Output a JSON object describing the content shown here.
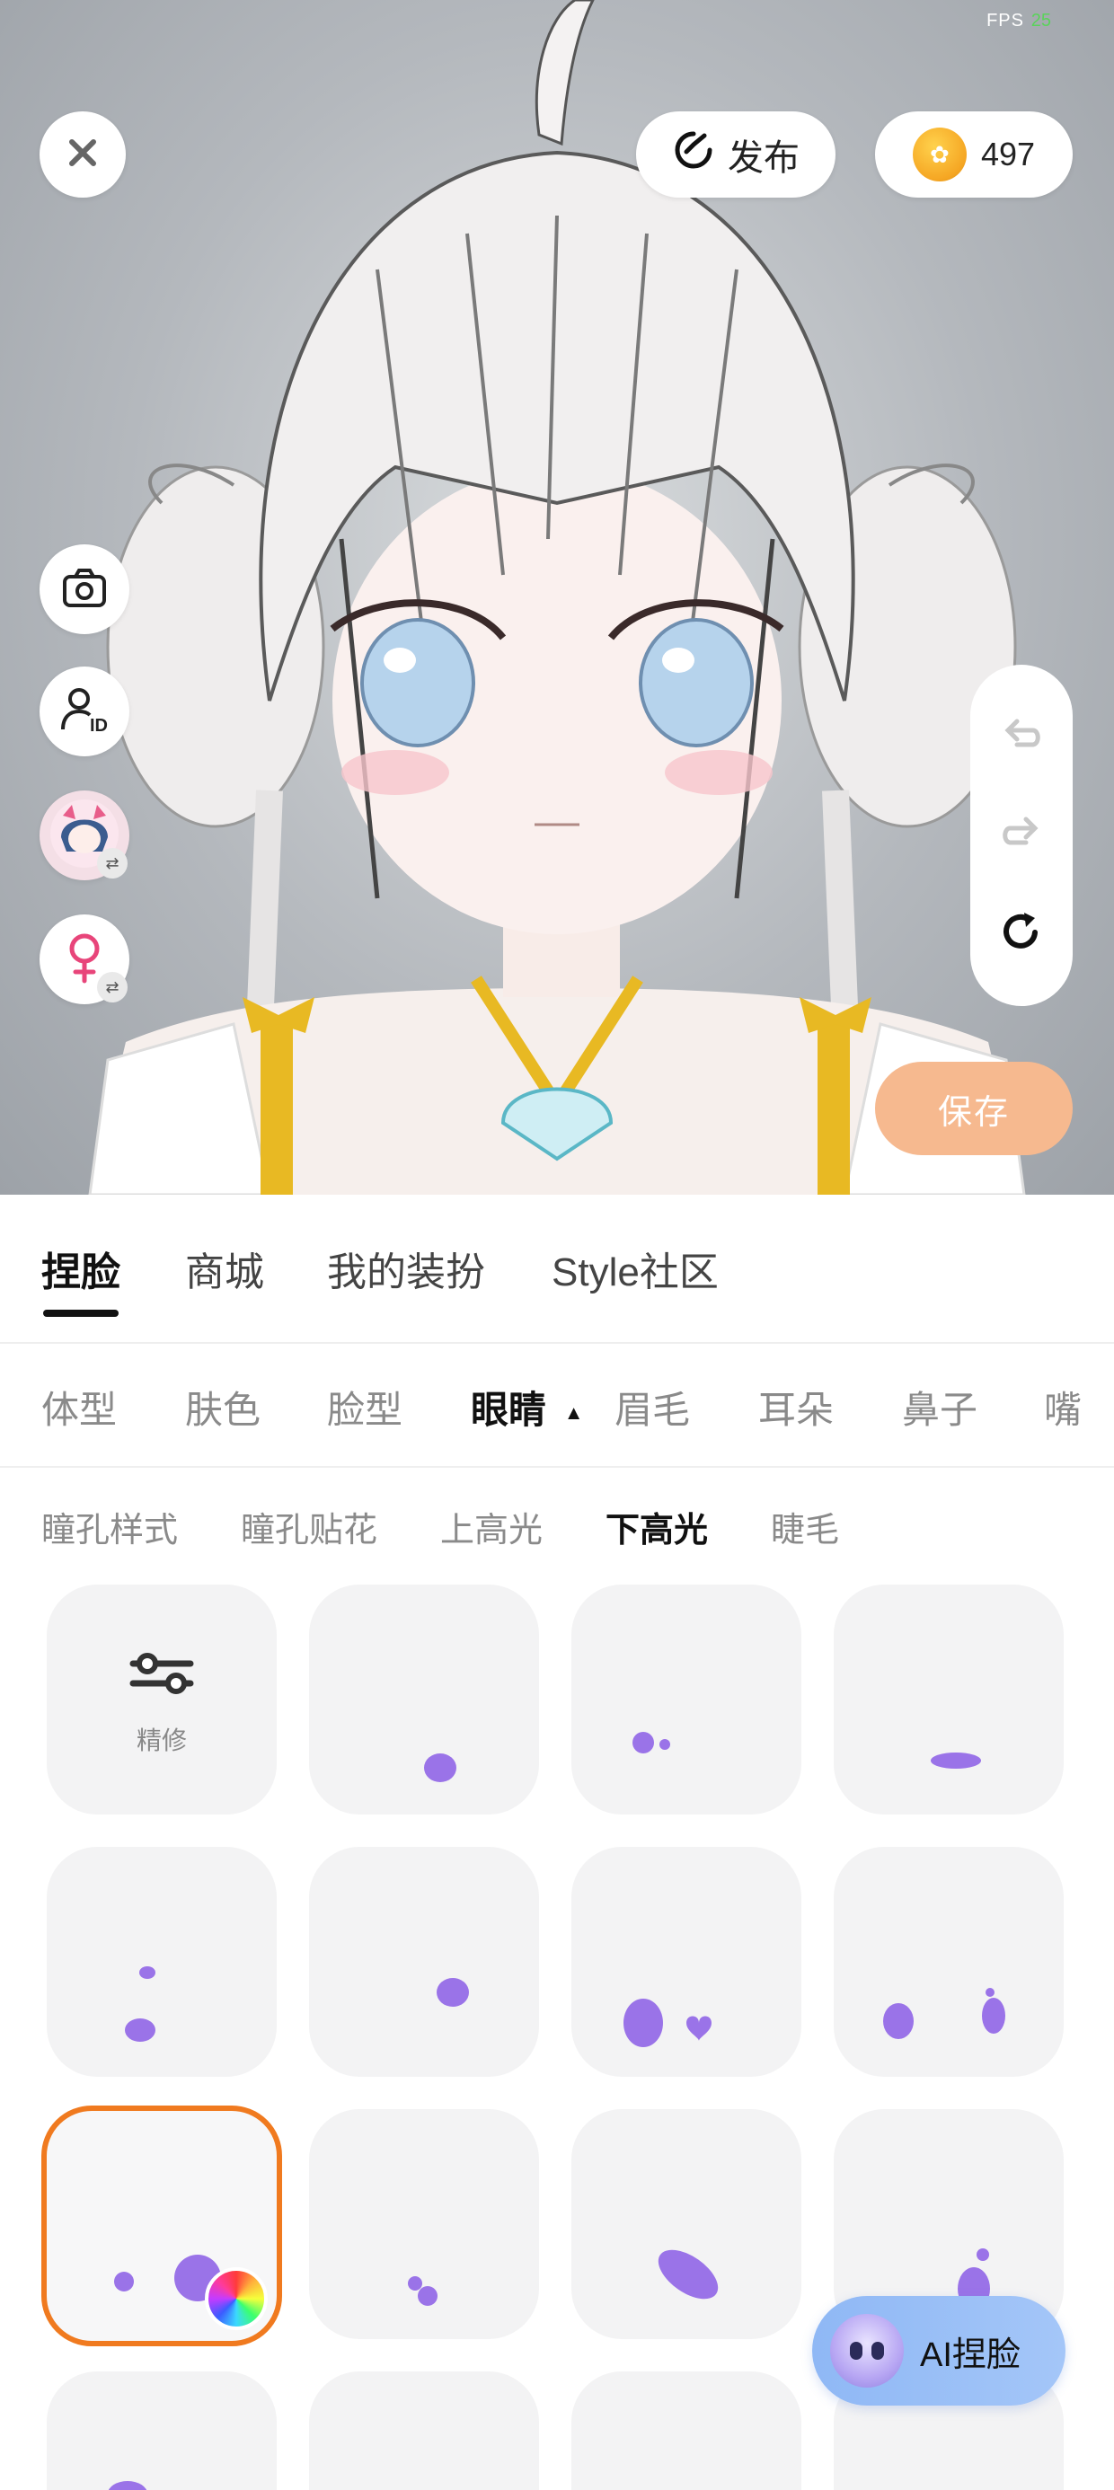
{
  "status": {
    "fps_label": "FPS",
    "fps_value": "25"
  },
  "header": {
    "publish_label": "发布",
    "coins": "497"
  },
  "side_tools": [
    {
      "name": "camera-button",
      "icon": "camera-icon"
    },
    {
      "name": "id-card-button",
      "icon": "user-id-icon"
    },
    {
      "name": "switch-avatar-button",
      "icon": "avatar-thumbnail"
    },
    {
      "name": "gender-button",
      "icon": "female-symbol-icon"
    }
  ],
  "history": {
    "undo_icon": "undo-icon",
    "redo_icon": "redo-icon",
    "reset_icon": "refresh-icon"
  },
  "save_label": "保存",
  "main_tabs": [
    {
      "label": "捏脸",
      "active": true
    },
    {
      "label": "商城"
    },
    {
      "label": "我的装扮"
    },
    {
      "label": "Style社区"
    }
  ],
  "categories": [
    {
      "label": "体型"
    },
    {
      "label": "肤色"
    },
    {
      "label": "脸型"
    },
    {
      "label": "眼睛",
      "active": true,
      "indicator": "▲"
    },
    {
      "label": "眉毛"
    },
    {
      "label": "耳朵"
    },
    {
      "label": "鼻子"
    },
    {
      "label": "嘴"
    }
  ],
  "sub_tabs": [
    {
      "label": "瞳孔样式"
    },
    {
      "label": "瞳孔贴花"
    },
    {
      "label": "上高光"
    },
    {
      "label": "下高光",
      "active": true
    },
    {
      "label": "睫毛"
    }
  ],
  "grid": {
    "refine_label": "精修",
    "highlight_color": "#9a73e8",
    "selected_border": "#f07a1f"
  },
  "ai_button_label": "AI捏脸"
}
